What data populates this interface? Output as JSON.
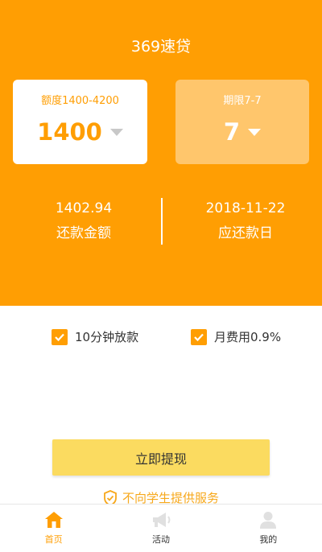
{
  "header": {
    "title": "369速贷"
  },
  "amount_card": {
    "label": "额度1400-4200",
    "value": "1400"
  },
  "term_card": {
    "label": "期限7-7",
    "value": "7"
  },
  "repay_info": {
    "amount_value": "1402.94",
    "amount_label": "还款金额",
    "date_value": "2018-11-22",
    "date_label": "应还款日"
  },
  "features": [
    {
      "label": "10分钟放款",
      "checked": true
    },
    {
      "label": "月费用0.9%",
      "checked": true
    }
  ],
  "withdraw_button": "立即提现",
  "notice": "不向学生提供服务",
  "tabs": [
    {
      "label": "首页",
      "icon": "home-icon",
      "active": true
    },
    {
      "label": "活动",
      "icon": "megaphone-icon",
      "active": false
    },
    {
      "label": "我的",
      "icon": "user-icon",
      "active": false
    }
  ],
  "colors": {
    "primary": "#ff9e03",
    "button": "#fbdb60",
    "notice": "#f7a81b"
  }
}
